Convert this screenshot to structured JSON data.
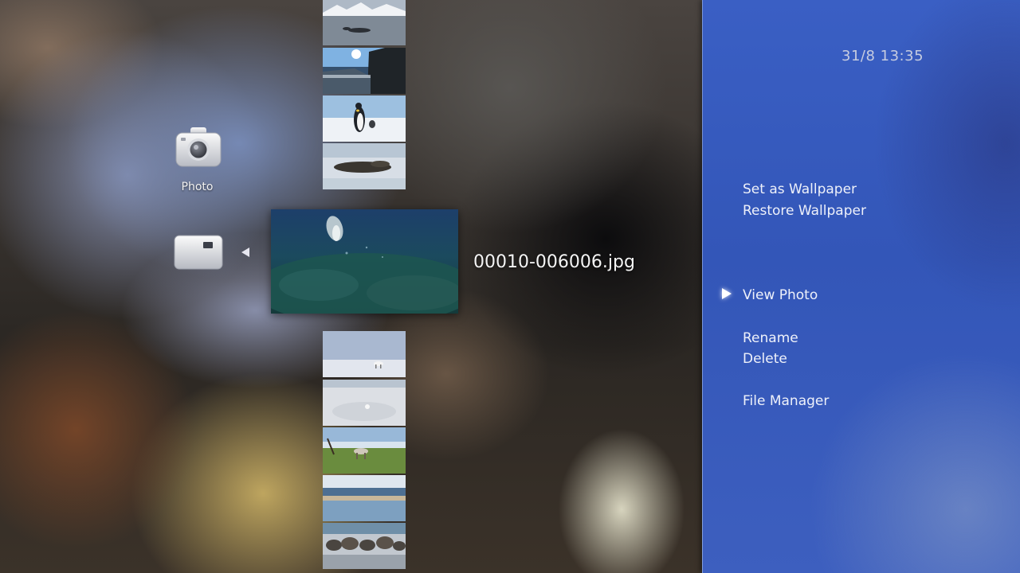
{
  "clock": "31/8 13:35",
  "category": {
    "label": "Photo",
    "icon": "camera-icon",
    "folder_icon": "folder-icon"
  },
  "selected_file": "00010-006006.jpg",
  "thumbnails_above": [
    {
      "icon": "snowy-mountains-seals"
    },
    {
      "icon": "sunlit-ice-cliff"
    },
    {
      "icon": "emperor-penguin"
    },
    {
      "icon": "penguin-colony-on-snow"
    }
  ],
  "thumbnails_below": [
    {
      "icon": "arctic-fox-on-snow"
    },
    {
      "icon": "snowfield"
    },
    {
      "icon": "caribou-on-tundra"
    },
    {
      "icon": "coastal-shoreline"
    },
    {
      "icon": "walrus-herd"
    }
  ],
  "options_menu": {
    "items": [
      {
        "label": "Set as Wallpaper"
      },
      {
        "label": "Restore Wallpaper"
      },
      {
        "label": "View Photo",
        "selected": true
      },
      {
        "label": "Rename"
      },
      {
        "label": "Delete"
      },
      {
        "label": "File Manager"
      }
    ]
  },
  "colors": {
    "panel": "#3a5fc4",
    "text": "#eef1fa"
  }
}
